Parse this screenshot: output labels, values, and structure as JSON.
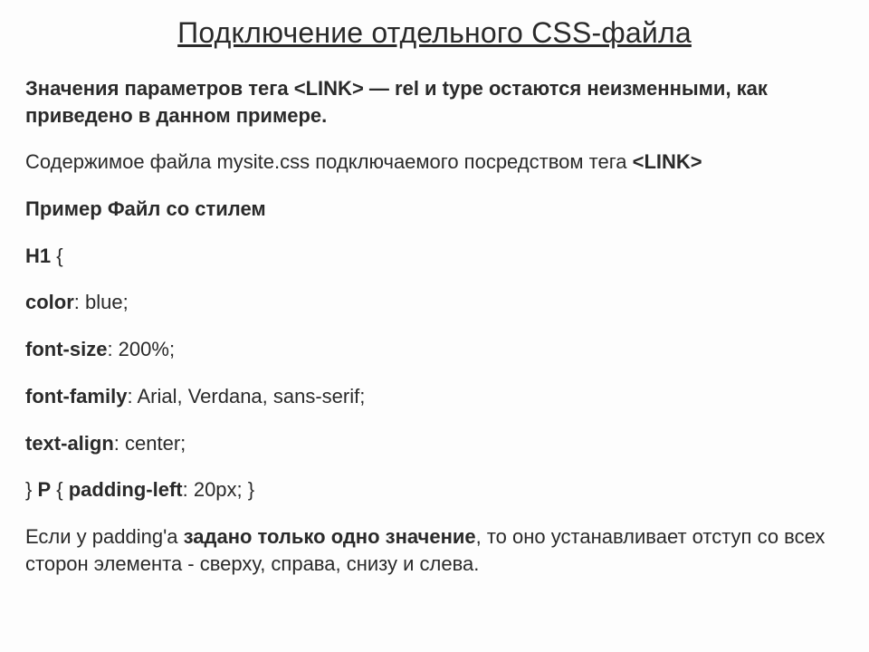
{
  "title": "Подключение отдельного CSS-файла",
  "intro_a": "Значения параметров тега ",
  "intro_tag": "<LINK>",
  "intro_b": " — rel и type остаются неизменными, как приведено в данном примере.",
  "file_a": "Содержимое файла mysite.css подключаемого посредством тега ",
  "file_tag": "<LINK>",
  "example_label": "Пример Файл со стилем",
  "rule1_selector": "H1",
  "rule1_open": "  {",
  "rule1_prop1": "color",
  "rule1_val1": ": blue;",
  "rule1_prop2": "font-size",
  "rule1_val2": ": 200%;",
  "rule1_prop3": " font-family",
  "rule1_val3": ": Arial, Verdana, sans-serif;",
  "rule1_prop4": "text-align",
  "rule1_val4": ": center;",
  "rule2_a": "} ",
  "rule2_sel": "P",
  "rule2_b": " { ",
  "rule2_prop": "padding-left",
  "rule2_val": ": 20px; }",
  "note_a": " Если у padding'а ",
  "note_bold": "задано только одно значение",
  "note_b": ", то оно устанавливает отступ со всех сторон элемента - сверху, справа, снизу и слева."
}
